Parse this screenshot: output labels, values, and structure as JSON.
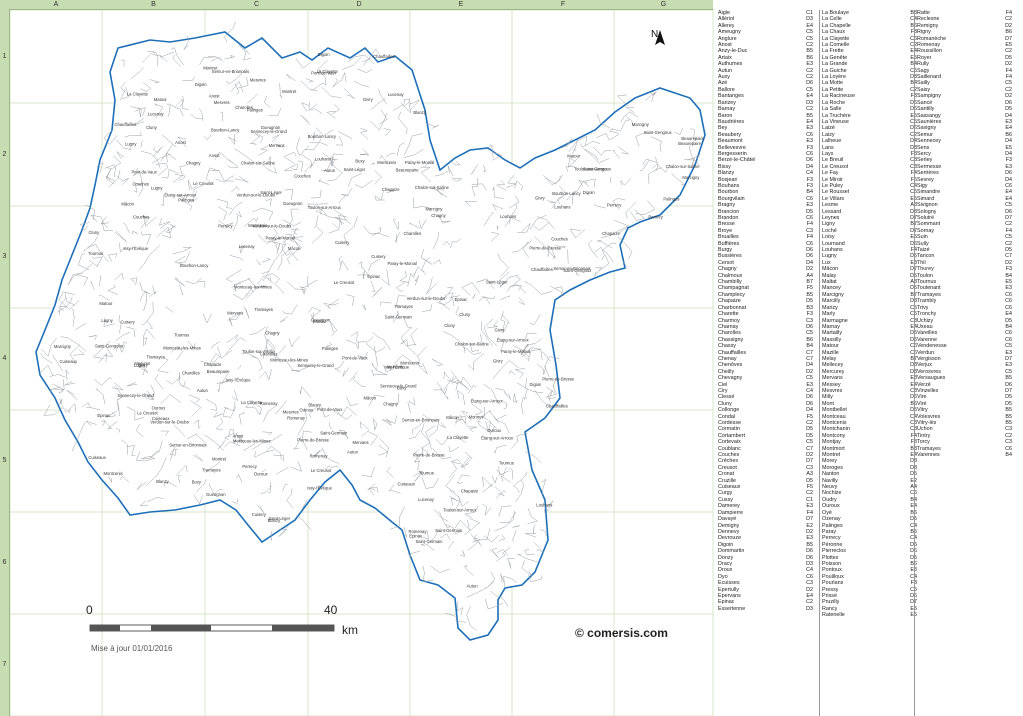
{
  "grid": {
    "columns": [
      "A",
      "B",
      "C",
      "D",
      "E",
      "F",
      "G"
    ],
    "rows": [
      "1",
      "2",
      "3",
      "4",
      "5",
      "6",
      "7"
    ]
  },
  "north_label": "N",
  "scale": {
    "start": "0",
    "end": "40",
    "unit": "km"
  },
  "copyright": "© comersis.com",
  "update": "Mise à jour 01/01/2016",
  "colors": {
    "border": "#1d6fb8",
    "grid": "#d8e4c8",
    "ruler": "#c7dcb0"
  },
  "index_columns": [
    [
      [
        "Aigle",
        "C1"
      ],
      [
        "Allériot",
        "D3"
      ],
      [
        "Allerey",
        "E4"
      ],
      [
        "Ameugny",
        "C5"
      ],
      [
        "Anglure",
        "C5"
      ],
      [
        "Anost",
        "C2"
      ],
      [
        "Anzy-le-Duc",
        "B5"
      ],
      [
        "Artaix",
        "B6"
      ],
      [
        "Authumes",
        "E3"
      ],
      [
        "Autun",
        "C2"
      ],
      [
        "Auxy",
        "C2"
      ],
      [
        "Azé",
        "D6"
      ],
      [
        "Ballore",
        "C5"
      ],
      [
        "Bantanges",
        "E4"
      ],
      [
        "Barizey",
        "D3"
      ],
      [
        "Barnay",
        "C2"
      ],
      [
        "Baron",
        "B5"
      ],
      [
        "Baudrières",
        "E4"
      ],
      [
        "Bey",
        "E3"
      ],
      [
        "Beaubery",
        "C6"
      ],
      [
        "Beaumont",
        "E3"
      ],
      [
        "Bellevesvre",
        "F3"
      ],
      [
        "Bergesserin",
        "C6"
      ],
      [
        "Berzé-le-Châtel",
        "D6"
      ],
      [
        "Bissy",
        "D4"
      ],
      [
        "Blanzy",
        "C4"
      ],
      [
        "Bosjean",
        "F3"
      ],
      [
        "Bouhans",
        "F3"
      ],
      [
        "Bourbon",
        "B4"
      ],
      [
        "Bourgvilain",
        "C6"
      ],
      [
        "Bragny",
        "E3"
      ],
      [
        "Brancion",
        "D5"
      ],
      [
        "Brandon",
        "C6"
      ],
      [
        "Bresse",
        "F4"
      ],
      [
        "Broye",
        "C3"
      ],
      [
        "Bruailles",
        "F4"
      ],
      [
        "Buffières",
        "C6"
      ],
      [
        "Burgy",
        "D6"
      ],
      [
        "Bussières",
        "D6"
      ],
      [
        "Cersot",
        "D4"
      ],
      [
        "Chagny",
        "D2"
      ],
      [
        "Chalmoux",
        "A4"
      ],
      [
        "Chambilly",
        "B7"
      ],
      [
        "Champagnat",
        "F5"
      ],
      [
        "Champlecy",
        "B5"
      ],
      [
        "Chapaize",
        "D5"
      ],
      [
        "Charbonnat",
        "B3"
      ],
      [
        "Charette",
        "F3"
      ],
      [
        "Charmoy",
        "C3"
      ],
      [
        "Charnay",
        "D6"
      ],
      [
        "Charolles",
        "C5"
      ],
      [
        "Chassigny",
        "B6"
      ],
      [
        "Chassy",
        "B4"
      ],
      [
        "Chauffailles",
        "C7"
      ],
      [
        "Chenay",
        "C7"
      ],
      [
        "Chenôves",
        "D4"
      ],
      [
        "Cheilly",
        "D2"
      ],
      [
        "Chevagny",
        "C5"
      ],
      [
        "Ciel",
        "E3"
      ],
      [
        "Ciry",
        "C4"
      ],
      [
        "Clessé",
        "D6"
      ],
      [
        "Cluny",
        "D6"
      ],
      [
        "Collonge",
        "D4"
      ],
      [
        "Condal",
        "F5"
      ],
      [
        "Cordesse",
        "C2"
      ],
      [
        "Cormatin",
        "D5"
      ],
      [
        "Cortambert",
        "D5"
      ],
      [
        "Cortevaix",
        "C5"
      ],
      [
        "Coublanc",
        "C7"
      ],
      [
        "Couches",
        "D2"
      ],
      [
        "Crêches",
        "D7"
      ],
      [
        "Creusot",
        "C3"
      ],
      [
        "Cronat",
        "A3"
      ],
      [
        "Cruzille",
        "D5"
      ],
      [
        "Cuiseaux",
        "F5"
      ],
      [
        "Curgy",
        "C2"
      ],
      [
        "Cussy",
        "C1"
      ],
      [
        "Damerey",
        "E3"
      ],
      [
        "Dampierre",
        "F4"
      ],
      [
        "Davayé",
        "D7"
      ],
      [
        "Demigny",
        "E2"
      ],
      [
        "Dennevy",
        "D2"
      ],
      [
        "Devrouze",
        "E3"
      ],
      [
        "Digoin",
        "B5"
      ],
      [
        "Dommartin",
        "D6"
      ],
      [
        "Donzy",
        "D6"
      ],
      [
        "Dracy",
        "D3"
      ],
      [
        "Droux",
        "C4"
      ],
      [
        "Dyo",
        "C6"
      ],
      [
        "Écuisses",
        "C3"
      ],
      [
        "Épertully",
        "D2"
      ],
      [
        "Épervans",
        "E4"
      ],
      [
        "Épinac",
        "C2"
      ],
      [
        "Essertenne",
        "D3"
      ]
    ],
    [
      [
        "La Boulaye",
        "B3"
      ],
      [
        "La Celle",
        "C4"
      ],
      [
        "La Chapelle",
        "B6"
      ],
      [
        "La Chaux",
        "F3"
      ],
      [
        "La Clayette",
        "C6"
      ],
      [
        "La Comelle",
        "C2"
      ],
      [
        "La Frette",
        "E4"
      ],
      [
        "La Genête",
        "E5"
      ],
      [
        "La Grande",
        "B4"
      ],
      [
        "La Guiche",
        "C5"
      ],
      [
        "La Loyère",
        "D3"
      ],
      [
        "La Motte",
        "B4"
      ],
      [
        "La Petite",
        "C2"
      ],
      [
        "La Racineuse",
        "F3"
      ],
      [
        "La Roche",
        "D6"
      ],
      [
        "La Salle",
        "D6"
      ],
      [
        "La Truchère",
        "E5"
      ],
      [
        "La Vineuse",
        "C5"
      ],
      [
        "Laizé",
        "D6"
      ],
      [
        "Laizy",
        "C2"
      ],
      [
        "Lalheue",
        "D4"
      ],
      [
        "Lans",
        "D3"
      ],
      [
        "Lays",
        "F3"
      ],
      [
        "Le Breuil",
        "C3"
      ],
      [
        "Le Creusot",
        "C3"
      ],
      [
        "Le Fay",
        "F4"
      ],
      [
        "Le Miroir",
        "F5"
      ],
      [
        "Le Puley",
        "C4"
      ],
      [
        "Le Rousset",
        "C5"
      ],
      [
        "Le Villars",
        "E5"
      ],
      [
        "Lesme",
        "A3"
      ],
      [
        "Lessard",
        "D3"
      ],
      [
        "Leynes",
        "D7"
      ],
      [
        "Ligny",
        "B7"
      ],
      [
        "Loché",
        "D7"
      ],
      [
        "Loisy",
        "E5"
      ],
      [
        "Lournand",
        "D6"
      ],
      [
        "Louhans",
        "F4"
      ],
      [
        "Lugny",
        "D5"
      ],
      [
        "Lux",
        "E3"
      ],
      [
        "Mâcon",
        "D7"
      ],
      [
        "Malay",
        "D5"
      ],
      [
        "Maltat",
        "A3"
      ],
      [
        "Mancey",
        "D5"
      ],
      [
        "Marcigny",
        "B7"
      ],
      [
        "Marcilly",
        "D3"
      ],
      [
        "Marizy",
        "C5"
      ],
      [
        "Marly",
        "C5"
      ],
      [
        "Marmagne",
        "C3"
      ],
      [
        "Marnay",
        "E4"
      ],
      [
        "Martailly",
        "D5"
      ],
      [
        "Massilly",
        "D5"
      ],
      [
        "Matour",
        "C6"
      ],
      [
        "Mazille",
        "C6"
      ],
      [
        "Melay",
        "B7"
      ],
      [
        "Mellecey",
        "D3"
      ],
      [
        "Mercurey",
        "D3"
      ],
      [
        "Mervans",
        "E3"
      ],
      [
        "Messey",
        "E4"
      ],
      [
        "Mesvres",
        "C3"
      ],
      [
        "Milly",
        "D6"
      ],
      [
        "Mont",
        "B5"
      ],
      [
        "Montbellet",
        "D5"
      ],
      [
        "Montceau",
        "C4"
      ],
      [
        "Montcenis",
        "C3"
      ],
      [
        "Montchanin",
        "C3"
      ],
      [
        "Montcony",
        "F4"
      ],
      [
        "Montjay",
        "F3"
      ],
      [
        "Montmort",
        "B3"
      ],
      [
        "Montret",
        "E4"
      ],
      [
        "Morey",
        "D3"
      ],
      [
        "Moroges",
        "D3"
      ],
      [
        "Nanton",
        "D5"
      ],
      [
        "Navilly",
        "E2"
      ],
      [
        "Neuvy",
        "A4"
      ],
      [
        "Nochize",
        "C6"
      ],
      [
        "Oudry",
        "B4"
      ],
      [
        "Ouroux",
        "E4"
      ],
      [
        "Oyé",
        "B6"
      ],
      [
        "Ozenay",
        "D5"
      ],
      [
        "Palinges",
        "C4"
      ],
      [
        "Paray",
        "B5"
      ],
      [
        "Perrecy",
        "C4"
      ],
      [
        "Péronne",
        "D6"
      ],
      [
        "Pierreclos",
        "D6"
      ],
      [
        "Plottes",
        "D5"
      ],
      [
        "Poisson",
        "B6"
      ],
      [
        "Pontoux",
        "E3"
      ],
      [
        "Pouilloux",
        "C4"
      ],
      [
        "Pourlans",
        "F3"
      ],
      [
        "Pressy",
        "C5"
      ],
      [
        "Prissé",
        "D6"
      ],
      [
        "Pruzilly",
        "D7"
      ],
      [
        "Rancy",
        "E5"
      ],
      [
        "Ratenelle",
        "E5"
      ]
    ],
    [
      [
        "Ratte",
        "F4"
      ],
      [
        "Reclesne",
        "C2"
      ],
      [
        "Remigny",
        "D2"
      ],
      [
        "Rigny",
        "B6"
      ],
      [
        "Romanèche",
        "D7"
      ],
      [
        "Romenay",
        "E5"
      ],
      [
        "Roussillon",
        "C2"
      ],
      [
        "Royer",
        "D5"
      ],
      [
        "Rully",
        "D2"
      ],
      [
        "Sagy",
        "F4"
      ],
      [
        "Saillenard",
        "F4"
      ],
      [
        "Sailly",
        "C5"
      ],
      [
        "Saisy",
        "C2"
      ],
      [
        "Sampigny",
        "D2"
      ],
      [
        "Sancé",
        "D6"
      ],
      [
        "Santilly",
        "D5"
      ],
      [
        "Sassangy",
        "D4"
      ],
      [
        "Saunières",
        "E3"
      ],
      [
        "Savigny",
        "E4"
      ],
      [
        "Semur",
        "B6"
      ],
      [
        "Sennecey",
        "D4"
      ],
      [
        "Sens",
        "E5"
      ],
      [
        "Sercy",
        "D4"
      ],
      [
        "Serley",
        "F3"
      ],
      [
        "Sermesse",
        "E3"
      ],
      [
        "Serrières",
        "D6"
      ],
      [
        "Sevrey",
        "D4"
      ],
      [
        "Sigy",
        "C6"
      ],
      [
        "Simandre",
        "E4"
      ],
      [
        "Simard",
        "E4"
      ],
      [
        "Sivignon",
        "C5"
      ],
      [
        "Sologny",
        "D6"
      ],
      [
        "Solutré",
        "D7"
      ],
      [
        "Sommant",
        "C2"
      ],
      [
        "Sornay",
        "F4"
      ],
      [
        "Suin",
        "C5"
      ],
      [
        "Sully",
        "C2"
      ],
      [
        "Taizé",
        "D5"
      ],
      [
        "Tancon",
        "C7"
      ],
      [
        "Thil",
        "D2"
      ],
      [
        "Thurey",
        "F3"
      ],
      [
        "Toulon",
        "B4"
      ],
      [
        "Tournus",
        "E5"
      ],
      [
        "Toutenant",
        "E3"
      ],
      [
        "Tramayes",
        "C6"
      ],
      [
        "Trambly",
        "C6"
      ],
      [
        "Trivy",
        "C6"
      ],
      [
        "Tronchy",
        "E4"
      ],
      [
        "Uchizy",
        "D5"
      ],
      [
        "Uxeau",
        "B4"
      ],
      [
        "Vareilles",
        "C6"
      ],
      [
        "Varenne",
        "C6"
      ],
      [
        "Vendenesse",
        "C5"
      ],
      [
        "Verdun",
        "E3"
      ],
      [
        "Vergisson",
        "D7"
      ],
      [
        "Verjux",
        "E3"
      ],
      [
        "Verosvres",
        "C5"
      ],
      [
        "Versaugues",
        "B5"
      ],
      [
        "Verzé",
        "D6"
      ],
      [
        "Vinzelles",
        "D7"
      ],
      [
        "Vire",
        "D5"
      ],
      [
        "Viré",
        "D5"
      ],
      [
        "Vitry",
        "B5"
      ],
      [
        "Volesvres",
        "B5"
      ],
      [
        "Vitry-lès",
        "B5"
      ],
      [
        "Uchon",
        "C3"
      ],
      [
        "Tintry",
        "C2"
      ],
      [
        "Torcy",
        "C3"
      ],
      [
        "Tramayes",
        "C6"
      ],
      [
        "Varennes",
        "B4"
      ]
    ]
  ],
  "communes": [
    "Autun",
    "Épinac",
    "Chagny",
    "Chalon-sur-Saône",
    "Le Creusot",
    "Montceau-les-Mines",
    "Digoin",
    "Paray-le-Monial",
    "Charolles",
    "Cluny",
    "Tournus",
    "Louhans",
    "Mâcon",
    "Marcigny",
    "Chauffailles",
    "La Clayette",
    "Cuiseaux",
    "Pierre-de-Bresse",
    "Gueugnon",
    "Bourbon-Lancy",
    "Toulon-sur-Arroux",
    "Matour",
    "Lugny",
    "Sennecey-le-Grand",
    "Givry",
    "Saint-Gengoux",
    "Buxy",
    "Verdun-sur-le-Doubs",
    "Cuisery",
    "Montret",
    "Beaurepaire",
    "Couches",
    "Mesvres",
    "Issy-l'Évêque",
    "Palinges",
    "Semur-en-Brionnais",
    "Tramayes",
    "Lucenay",
    "Anost",
    "Étang-sur-Arroux",
    "Saint-Léger",
    "Montcenis",
    "Blanzy",
    "Perrecy",
    "Romenay",
    "Pont-de-Vaux",
    "Saint-Germain",
    "Ouroux",
    "Chapaize",
    "Mervans"
  ]
}
